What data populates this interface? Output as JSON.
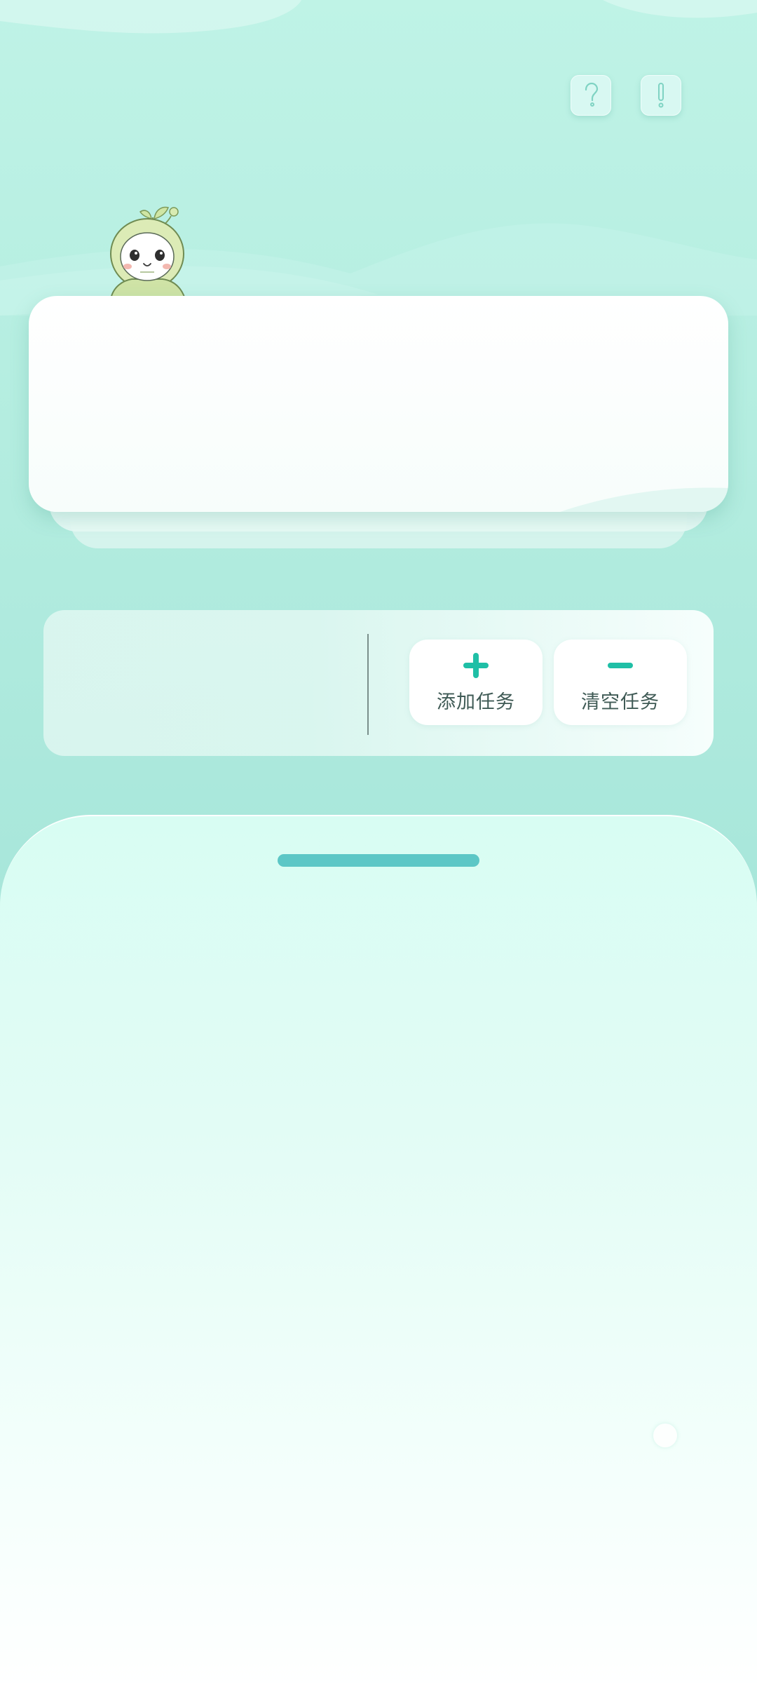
{
  "header": {
    "help_icon": "question-mark-icon",
    "info_icon": "exclamation-icon"
  },
  "colors": {
    "accent": "#1fbfa6",
    "handle": "#5cc7c6",
    "label_text": "#3f5a55",
    "background": "#b2ecdf"
  },
  "task_panel": {
    "add_button": {
      "label": "添加任务",
      "icon": "plus-icon"
    },
    "clear_button": {
      "label": "清空任务",
      "icon": "minus-icon"
    }
  }
}
